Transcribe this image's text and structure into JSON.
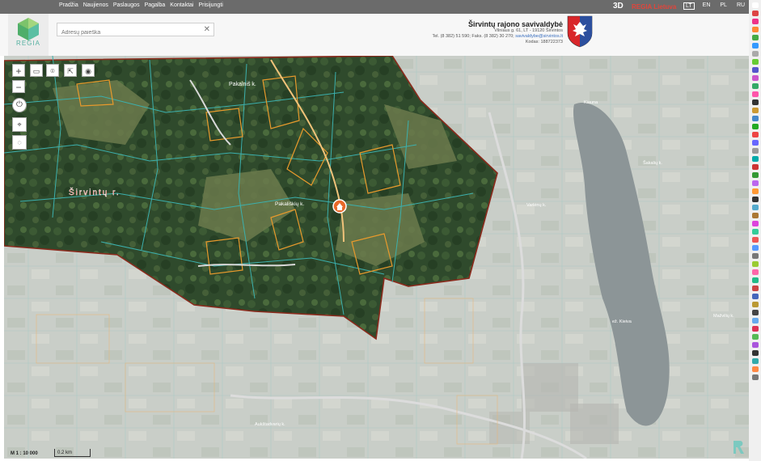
{
  "nav": {
    "items": [
      "Pradžia",
      "Naujienos",
      "Paslaugos",
      "Pagalba",
      "Kontaktai",
      "Prisijungti"
    ],
    "three_d": "3D",
    "regia_lt": "REGIA Lietuva",
    "langs": [
      "LT",
      "EN",
      "PL",
      "RU"
    ],
    "active_lang": "LT"
  },
  "logo": {
    "text": "REGIA"
  },
  "search": {
    "placeholder": "Adresų paieška"
  },
  "municipality": {
    "name": "Širvintų rajono savivaldybė",
    "address": "Vilniaus g. 61, LT - 19120 Širvintos",
    "phone_fax": "Tel. (8 382) 51 590; Faks. (8 382) 30 270;",
    "email": "savivaldybe@sirvintos.lt",
    "code": "Kodas: 188722373"
  },
  "map": {
    "labels": {
      "pakalniu": "Pakalniš k.",
      "sirvintu_r": "Širvintų r.",
      "pokaliskiu": "Pakališkių k.",
      "village_right1": "Varlėnų k.",
      "village_right2": "Šakalių k.",
      "kiauna": "Kiauna",
      "village_right3": "Mažvilių k.",
      "village_bottom": "Aukštadvarių k.",
      "lake": "ež. Kieiva"
    },
    "scale": "M 1 : 10 000",
    "scale_bar": "0.2 km",
    "colors": {
      "boundary": "#8a2a1c",
      "parcel": "#3cb0ad",
      "road": "#e89a2c",
      "highlight": "#e8692a"
    }
  },
  "toolbar": {
    "zoom_in": "+",
    "zoom_out": "−"
  }
}
